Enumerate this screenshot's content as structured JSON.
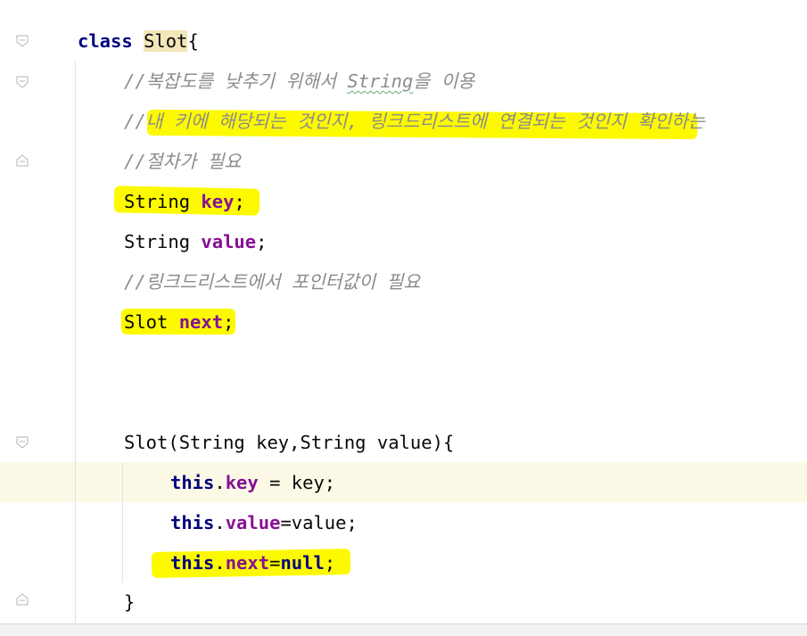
{
  "code": {
    "class_keyword": "class",
    "class_name": "Slot",
    "open_brace": "{",
    "comment_1_prefix": "//복잡도를 낮추기 위해서 ",
    "comment_1_typo": "String",
    "comment_1_suffix": "을 이용",
    "comment_2": "//내 키에 해당되는 것인지, 링크드리스트에 연결되는 것인지 확인하는",
    "comment_3": "//절차가 필요",
    "field_key_type": "String",
    "field_key_name": "key",
    "semicolon": ";",
    "field_value_type": "String",
    "field_value_name": "value",
    "comment_4": "//링크드리스트에서 포인터값이 필요",
    "field_next_type": "Slot",
    "field_next_name": "next",
    "constructor_signature": "Slot(String key,String value){",
    "this_kw": "this",
    "dot": ".",
    "assign_key_field": "key",
    "assign_key_rhs": " = key;",
    "assign_value_field": "value",
    "assign_value_rhs": "=value;",
    "assign_next_field": "next",
    "assign_next_eq": "=",
    "null_kw": "null",
    "close_brace": "}"
  },
  "colors": {
    "keyword": "#0033b3",
    "field": "#871094",
    "comment": "#8c8c8c",
    "highlighter": "#fdfa00",
    "caret_row": "#fcf9e6"
  },
  "icons": [
    "fold-collapse-icon",
    "fold-end-icon"
  ]
}
